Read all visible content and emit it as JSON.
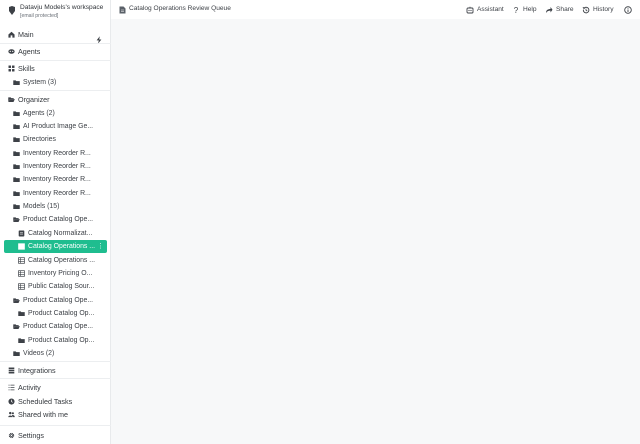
{
  "workspace": {
    "name": "Datavju Models's workspace",
    "email": "[email protected]"
  },
  "nav": {
    "main": "Main",
    "agents": "Agents",
    "skills": "Skills",
    "skills_system": "System (3)",
    "organizer": "Organizer",
    "tree": [
      {
        "label": "Agents (2)",
        "icon": "folder-icon"
      },
      {
        "label": "AI Product Image Ge...",
        "icon": "folder-icon"
      },
      {
        "label": "Directories",
        "icon": "folder-icon"
      },
      {
        "label": "Inventory Reorder R...",
        "icon": "folder-icon"
      },
      {
        "label": "Inventory Reorder R...",
        "icon": "folder-icon"
      },
      {
        "label": "Inventory Reorder R...",
        "icon": "folder-icon"
      },
      {
        "label": "Inventory Reorder R...",
        "icon": "folder-icon"
      },
      {
        "label": "Models (15)",
        "icon": "folder-icon"
      },
      {
        "label": "Product Catalog Ope...",
        "icon": "folder-open-icon"
      },
      {
        "label": "Catalog Normalizat...",
        "icon": "document-icon"
      },
      {
        "label": "Catalog Operations ...",
        "icon": "table-icon",
        "active": true
      },
      {
        "label": "Catalog Operations ...",
        "icon": "table-icon"
      },
      {
        "label": "Inventory Pricing O...",
        "icon": "table-icon"
      },
      {
        "label": "Public Catalog Sour...",
        "icon": "table-icon"
      },
      {
        "label": "Product Catalog Ope...",
        "icon": "folder-open-icon"
      },
      {
        "label": "Product Catalog Op...",
        "icon": "folder-icon"
      },
      {
        "label": "Product Catalog Ope...",
        "icon": "folder-open-icon"
      },
      {
        "label": "Product Catalog Op...",
        "icon": "folder-icon"
      },
      {
        "label": "Videos (2)",
        "icon": "folder-icon"
      }
    ],
    "integrations": "Integrations",
    "activity": "Activity",
    "scheduled_tasks": "Scheduled Tasks",
    "shared_with_me": "Shared with me",
    "settings": "Settings"
  },
  "topbar": {
    "doc_title": "Catalog Operations Review Queue",
    "assistant": "Assistant",
    "help": "Help",
    "share": "Share",
    "history": "History"
  },
  "colors": {
    "accent": "#1fbd8f",
    "sidebar_bg": "#ffffff",
    "main_bg": "#f7f8f9"
  }
}
